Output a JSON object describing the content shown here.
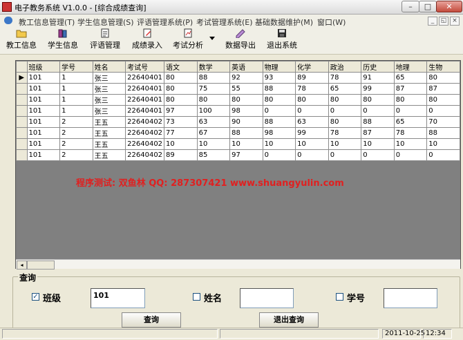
{
  "window": {
    "title": "电子教务系统 V1.0.0 - [综合成绩查询]",
    "caption_buttons": [
      "–",
      "□",
      "✕"
    ]
  },
  "menu": {
    "items": [
      "教工信息管理(T)",
      "学生信息管理(S)",
      "评语管理系统(P)",
      "考试管理系统(E)",
      "基础数据维护(M)",
      "窗口(W)"
    ],
    "mdi_buttons": [
      "_",
      "◱",
      "×"
    ]
  },
  "toolbar": {
    "buttons": [
      {
        "label": "教工信息",
        "icon": "folder-icon"
      },
      {
        "label": "学生信息",
        "icon": "books-icon"
      },
      {
        "label": "评语管理",
        "icon": "notepad-icon"
      },
      {
        "label": "成绩录入",
        "icon": "edit-document-icon"
      },
      {
        "label": "考试分析",
        "icon": "analysis-icon"
      },
      {
        "label": "数据导出",
        "icon": "export-icon"
      },
      {
        "label": "退出系统",
        "icon": "floppy-disk-icon"
      }
    ]
  },
  "grid": {
    "columns": [
      "班级",
      "学号",
      "姓名",
      "考试号",
      "语文",
      "数学",
      "英语",
      "物理",
      "化学",
      "政治",
      "历史",
      "地理",
      "生物"
    ],
    "rows": [
      [
        "101",
        "1",
        "张三",
        "22640401",
        "80",
        "88",
        "92",
        "93",
        "89",
        "78",
        "91",
        "65",
        "80"
      ],
      [
        "101",
        "1",
        "张三",
        "22640401",
        "80",
        "75",
        "55",
        "88",
        "78",
        "65",
        "99",
        "87",
        "87"
      ],
      [
        "101",
        "1",
        "张三",
        "22640401",
        "80",
        "80",
        "80",
        "80",
        "80",
        "80",
        "80",
        "80",
        "80"
      ],
      [
        "101",
        "1",
        "张三",
        "22640401",
        "97",
        "100",
        "98",
        "0",
        "0",
        "0",
        "0",
        "0",
        "0"
      ],
      [
        "101",
        "2",
        "王五",
        "22640402",
        "73",
        "63",
        "90",
        "88",
        "63",
        "80",
        "88",
        "65",
        "70"
      ],
      [
        "101",
        "2",
        "王五",
        "22640402",
        "77",
        "67",
        "88",
        "98",
        "99",
        "78",
        "87",
        "78",
        "88"
      ],
      [
        "101",
        "2",
        "王五",
        "22640402",
        "10",
        "10",
        "10",
        "10",
        "10",
        "10",
        "10",
        "10",
        "10"
      ],
      [
        "101",
        "2",
        "王五",
        "22640402",
        "89",
        "85",
        "97",
        "0",
        "0",
        "0",
        "0",
        "0",
        "0"
      ]
    ],
    "current_row_marker": "▶"
  },
  "watermark": "程序测试: 双鱼林  QQ: 287307421  www.shuangyulin.com",
  "query": {
    "legend": "查询",
    "class_label": "班级",
    "class_checked": true,
    "class_value": "101",
    "name_label": "姓名",
    "name_checked": false,
    "name_value": "",
    "studentno_label": "学号",
    "studentno_checked": false,
    "studentno_value": "",
    "search_button": "查询",
    "exit_button": "退出查询"
  },
  "status": {
    "date": "2011-10-25",
    "time": "12:34"
  },
  "colors": {
    "watermark": "#e02020",
    "window_bg": "#ece9d8",
    "grid_bg": "#808080"
  }
}
